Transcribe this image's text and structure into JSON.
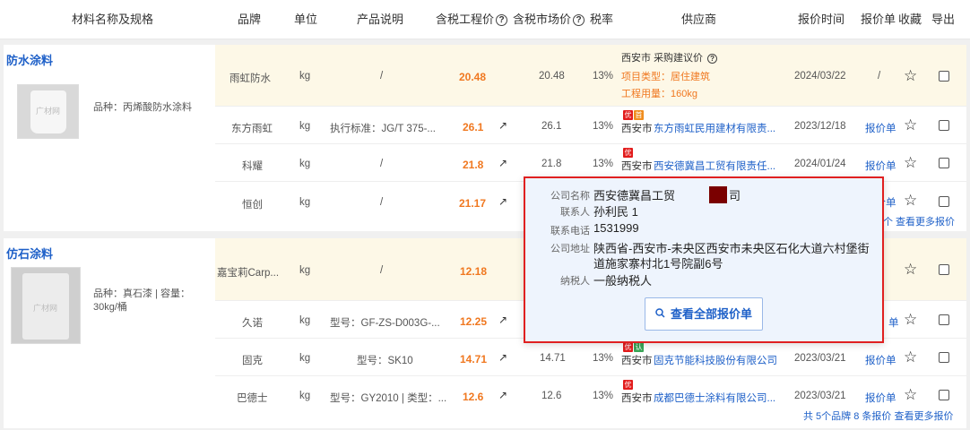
{
  "header": {
    "col_name": "材料名称及规格",
    "col_brand": "品牌",
    "col_unit": "单位",
    "col_desc": "产品说明",
    "col_eng_price": "含税工程价",
    "col_market_price": "含税市场价",
    "col_tax": "税率",
    "col_supplier": "供应商",
    "col_time": "报价时间",
    "col_quote": "报价单",
    "col_fav": "收藏",
    "col_export": "导出"
  },
  "sections": [
    {
      "title": "防水涂料",
      "desc": "品种：丙烯酸防水涂料",
      "image_label": "广材网",
      "rows": [
        {
          "brand": "雨虹防水",
          "unit": "kg",
          "desc": "/",
          "eng_price": "20.48",
          "market_price": "20.48",
          "tax": "13%",
          "supplier_city": "西安市",
          "supplier_name": "采购建议价",
          "project_type": "项目类型：居住建筑",
          "project_qty": "工程用量：160kg",
          "time": "2024/03/22",
          "quote": "/"
        },
        {
          "brand": "东方雨虹",
          "unit": "kg",
          "desc": "执行标准：JG/T 375-...",
          "eng_price": "26.1",
          "market_price": "26.1",
          "tax": "13%",
          "badges": [
            "优",
            "首"
          ],
          "supplier_city": "西安市",
          "supplier_name": "东方雨虹民用建材有限责...",
          "time": "2023/12/18",
          "quote": "报价单"
        },
        {
          "brand": "科耀",
          "unit": "kg",
          "desc": "/",
          "eng_price": "21.8",
          "market_price": "21.8",
          "tax": "13%",
          "badges": [
            "优"
          ],
          "supplier_city": "西安市",
          "supplier_name": "西安德冀昌工贸有限责任...",
          "time": "2024/01/24",
          "quote": "报价单"
        },
        {
          "brand": "恒创",
          "unit": "kg",
          "desc": "/",
          "eng_price": "21.17",
          "quote": "报价单",
          "more": "个 查看更多报价"
        }
      ]
    },
    {
      "title": "仿石涂料",
      "desc": "品种：真石漆 | 容量：30kg/桶",
      "image_label": "广材网",
      "rows": [
        {
          "brand": "嘉宝莉Carp...",
          "unit": "kg",
          "desc": "/",
          "eng_price": "12.18"
        },
        {
          "brand": "久诺",
          "unit": "kg",
          "desc": "型号：GF-ZS-D003G-...",
          "eng_price": "12.25",
          "quote": "单"
        },
        {
          "brand": "固克",
          "unit": "kg",
          "desc": "型号：SK10",
          "eng_price": "14.71",
          "market_price": "14.71",
          "tax": "13%",
          "badges": [
            "优",
            "认"
          ],
          "supplier_city": "西安市",
          "supplier_name": "固克节能科技股份有限公司",
          "time": "2023/03/21",
          "quote": "报价单"
        },
        {
          "brand": "巴德士",
          "unit": "kg",
          "desc": "型号：GY2010 | 类型：...",
          "eng_price": "12.6",
          "market_price": "12.6",
          "tax": "13%",
          "badges": [
            "优"
          ],
          "supplier_city": "西安市",
          "supplier_name": "成都巴德士涂料有限公司...",
          "time": "2023/03/21",
          "quote": "报价单"
        }
      ],
      "footer": "共 5个品牌 8 条报价 查看更多报价"
    }
  ],
  "popup": {
    "company_label": "公司名称",
    "company_value": "西安德冀昌工贸",
    "company_suffix": "司",
    "contact_label": "联系人",
    "contact_value": "孙利民 1",
    "phone_label": "联系电话",
    "phone_value": "1531999",
    "address_label": "公司地址",
    "address_line1": "陕西省-西安市-未央区西安市未央区石化大道六村堡街",
    "address_line2": "道施家寨村北1号院副6号",
    "taxpayer_label": "纳税人",
    "taxpayer_value": "一般纳税人",
    "button_label": "查看全部报价单"
  },
  "colors": {
    "accent": "#1e60c8",
    "price": "#f07820",
    "popup_border": "#e02020",
    "highlight_row": "#fdf8e7"
  }
}
